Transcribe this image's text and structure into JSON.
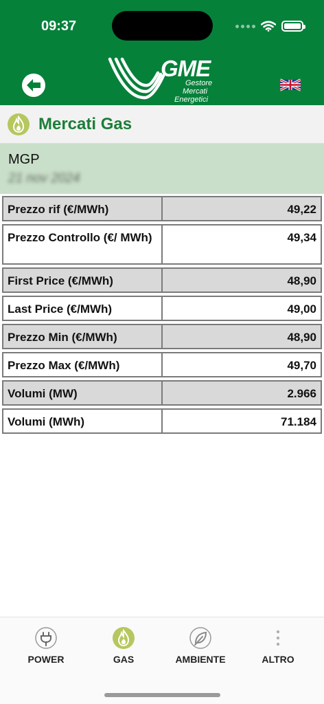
{
  "status_bar": {
    "time": "09:37"
  },
  "header": {
    "logo_text": "GME",
    "logo_subtitle": [
      "Gestore",
      "Mercati",
      "Energetici"
    ],
    "back_icon": "arrow-left-icon",
    "language_icon": "uk-flag-icon",
    "background_color": "#06813a"
  },
  "section": {
    "title": "Mercati Gas",
    "icon": "flame-icon"
  },
  "market": {
    "name": "MGP",
    "date": "21 nov 2024"
  },
  "table": {
    "rows": [
      {
        "label": "Prezzo rif (€/MWh)",
        "value": "49,22"
      },
      {
        "label": "Prezzo Controllo (€/ MWh)",
        "value": "49,34"
      },
      {
        "label": "First Price (€/MWh)",
        "value": "48,90"
      },
      {
        "label": "Last Price (€/MWh)",
        "value": "49,00"
      },
      {
        "label": "Prezzo Min (€/MWh)",
        "value": "48,90"
      },
      {
        "label": "Prezzo Max (€/MWh)",
        "value": "49,70"
      },
      {
        "label": "Volumi (MW)",
        "value": "2.966"
      },
      {
        "label": "Volumi (MWh)",
        "value": "71.184"
      }
    ]
  },
  "tabbar": {
    "tabs": [
      {
        "label": "POWER",
        "icon": "plug-icon"
      },
      {
        "label": "GAS",
        "icon": "flame-icon",
        "active": true
      },
      {
        "label": "AMBIENTE",
        "icon": "leaf-icon"
      },
      {
        "label": "ALTRO",
        "icon": "more-icon"
      }
    ]
  }
}
